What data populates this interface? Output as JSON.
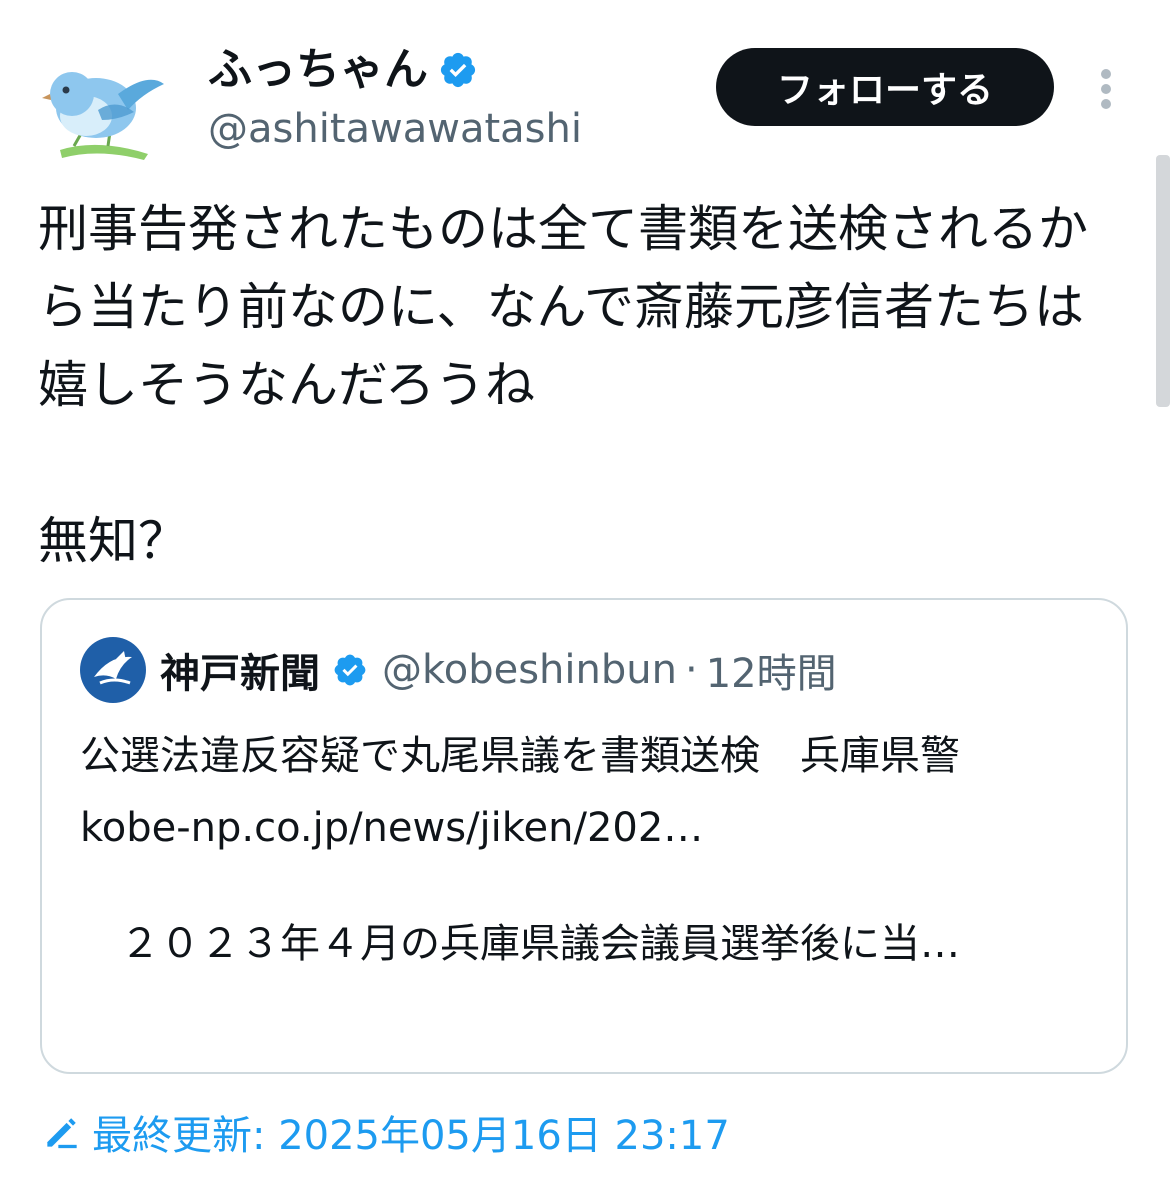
{
  "user": {
    "display_name": "ふっちゃん",
    "handle": "@ashitawawatashi",
    "verified": true
  },
  "actions": {
    "follow_label": "フォローする"
  },
  "tweet": {
    "text_paragraph1": "刑事告発されたものは全て書類を送検される​から当たり前なのに、なんで斎藤元彦信者たちは嬉しそうなんだろうね",
    "text_paragraph2": "無知？"
  },
  "quote": {
    "name": "神戸新聞",
    "handle": "@kobeshinbun",
    "separator": "·",
    "time": "12時間",
    "headline": "公選法違反容疑で丸尾県議を書類送検　兵庫県警",
    "link": "kobe-np.co.jp/news/jiken/202…",
    "excerpt": "　２０２３年４月の兵庫県議会議員選挙後に当…"
  },
  "footer": {
    "last_updated": "最終更新: 2025年05月16日 23:17"
  },
  "colors": {
    "accent": "#1d9bf0",
    "text": "#0f1419",
    "secondary_text": "#536471",
    "border": "#cfd9de",
    "button_bg": "#0f1419"
  },
  "icons": {
    "avatar": "blue-bird-on-branch",
    "verified": "verified-badge-icon",
    "more": "more-vertical-icon",
    "quote_avatar": "kobe-shinbun-logo",
    "edit": "pencil-icon"
  }
}
